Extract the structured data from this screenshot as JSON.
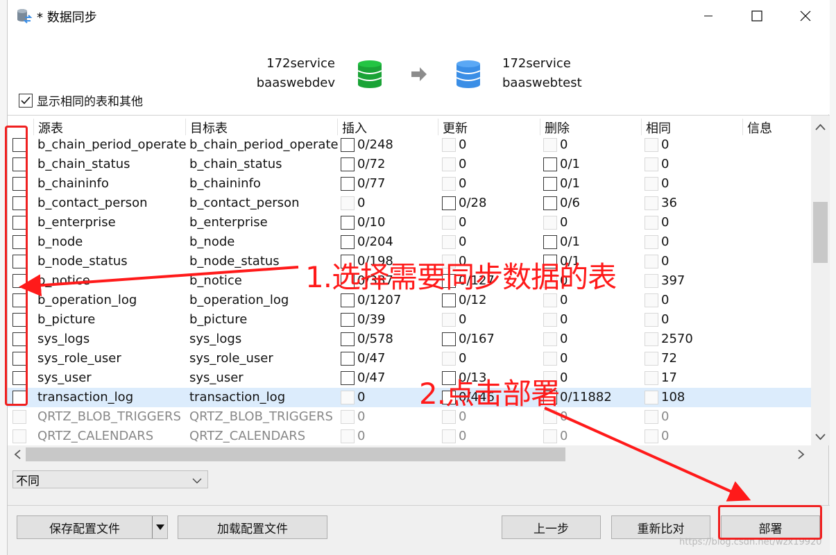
{
  "window": {
    "title": "* 数据同步",
    "minimize_label": "minimize",
    "maximize_label": "maximize",
    "close_label": "close"
  },
  "source": {
    "server": "172service",
    "database": "baaswebdev",
    "icon_color": "#1aa336"
  },
  "target": {
    "server": "172service",
    "database": "baaswebtest",
    "icon_color": "#3a8ee6"
  },
  "show_same_label": "显示相同的表和其他",
  "columns": [
    "源表",
    "目标表",
    "插入",
    "更新",
    "删除",
    "相同",
    "信息"
  ],
  "rows": [
    {
      "src": "b_chain_period_operate",
      "tgt": "b_chain_period_operate",
      "insert": "0/248",
      "update": "0",
      "delete": "0",
      "same": "0"
    },
    {
      "src": "b_chain_status",
      "tgt": "b_chain_status",
      "insert": "0/72",
      "update": "0",
      "delete": "0/1",
      "same": "0"
    },
    {
      "src": "b_chaininfo",
      "tgt": "b_chaininfo",
      "insert": "0/77",
      "update": "0",
      "delete": "0/1",
      "same": "0"
    },
    {
      "src": "b_contact_person",
      "tgt": "b_contact_person",
      "insert": "0",
      "update": "0/28",
      "delete": "0/6",
      "same": "36"
    },
    {
      "src": "b_enterprise",
      "tgt": "b_enterprise",
      "insert": "0/10",
      "update": "0",
      "delete": "0",
      "same": "0"
    },
    {
      "src": "b_node",
      "tgt": "b_node",
      "insert": "0/204",
      "update": "0",
      "delete": "0/1",
      "same": "0"
    },
    {
      "src": "b_node_status",
      "tgt": "b_node_status",
      "insert": "0/198",
      "update": "0",
      "delete": "0/1",
      "same": "0"
    },
    {
      "src": "b_notice",
      "tgt": "b_notice",
      "insert": "0/387",
      "update": "0/127",
      "delete": "0",
      "same": "397"
    },
    {
      "src": "b_operation_log",
      "tgt": "b_operation_log",
      "insert": "0/1207",
      "update": "0/12",
      "delete": "0",
      "same": "0"
    },
    {
      "src": "b_picture",
      "tgt": "b_picture",
      "insert": "0/39",
      "update": "0",
      "delete": "0",
      "same": "0"
    },
    {
      "src": "sys_logs",
      "tgt": "sys_logs",
      "insert": "0/578",
      "update": "0/167",
      "delete": "0",
      "same": "2570"
    },
    {
      "src": "sys_role_user",
      "tgt": "sys_role_user",
      "insert": "0/47",
      "update": "0",
      "delete": "0",
      "same": "72"
    },
    {
      "src": "sys_user",
      "tgt": "sys_user",
      "insert": "0/47",
      "update": "0/13",
      "delete": "0",
      "same": "17"
    },
    {
      "src": "transaction_log",
      "tgt": "transaction_log",
      "insert": "0",
      "update": "0/446",
      "delete": "0/11882",
      "same": "108"
    },
    {
      "src": "QRTZ_BLOB_TRIGGERS",
      "tgt": "QRTZ_BLOB_TRIGGERS",
      "insert": "0",
      "update": "0",
      "delete": "0",
      "same": "0"
    },
    {
      "src": "QRTZ_CALENDARS",
      "tgt": "QRTZ_CALENDARS",
      "insert": "0",
      "update": "0",
      "delete": "0",
      "same": "0"
    }
  ],
  "filter": {
    "selected": "不同"
  },
  "buttons": {
    "save_config": "保存配置文件",
    "load_config": "加载配置文件",
    "back": "上一步",
    "recompare": "重新比对",
    "deploy": "部署"
  },
  "annotations": {
    "step1": "1.选择需要同步数据的表",
    "step2": "2.点击部署",
    "color": "#ff1a1a"
  },
  "watermark": "https://blog.csdn.net/wzx19920"
}
